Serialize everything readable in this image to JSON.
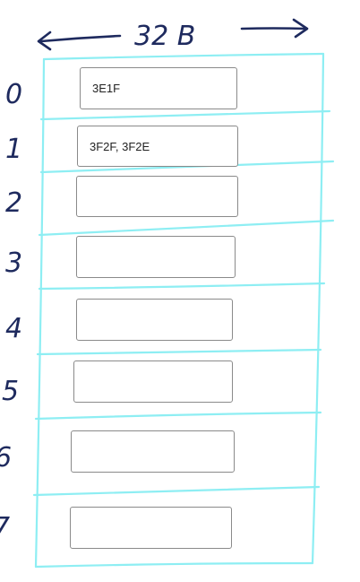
{
  "header": {
    "width_label": "32 B"
  },
  "rows": [
    {
      "index_label": "0",
      "value": "3E1F"
    },
    {
      "index_label": "1",
      "value": "3F2F, 3F2E"
    },
    {
      "index_label": "2",
      "value": ""
    },
    {
      "index_label": "3",
      "value": ""
    },
    {
      "index_label": "4",
      "value": ""
    },
    {
      "index_label": "5",
      "value": ""
    },
    {
      "index_label": "6",
      "value": ""
    },
    {
      "index_label": "7",
      "value": ""
    }
  ],
  "colors": {
    "grid_stroke": "#8eeef3",
    "ink": "#1e2a5e",
    "input_border": "#8a8a8a"
  },
  "icons": [
    "arrow-left-icon",
    "arrow-right-icon"
  ]
}
